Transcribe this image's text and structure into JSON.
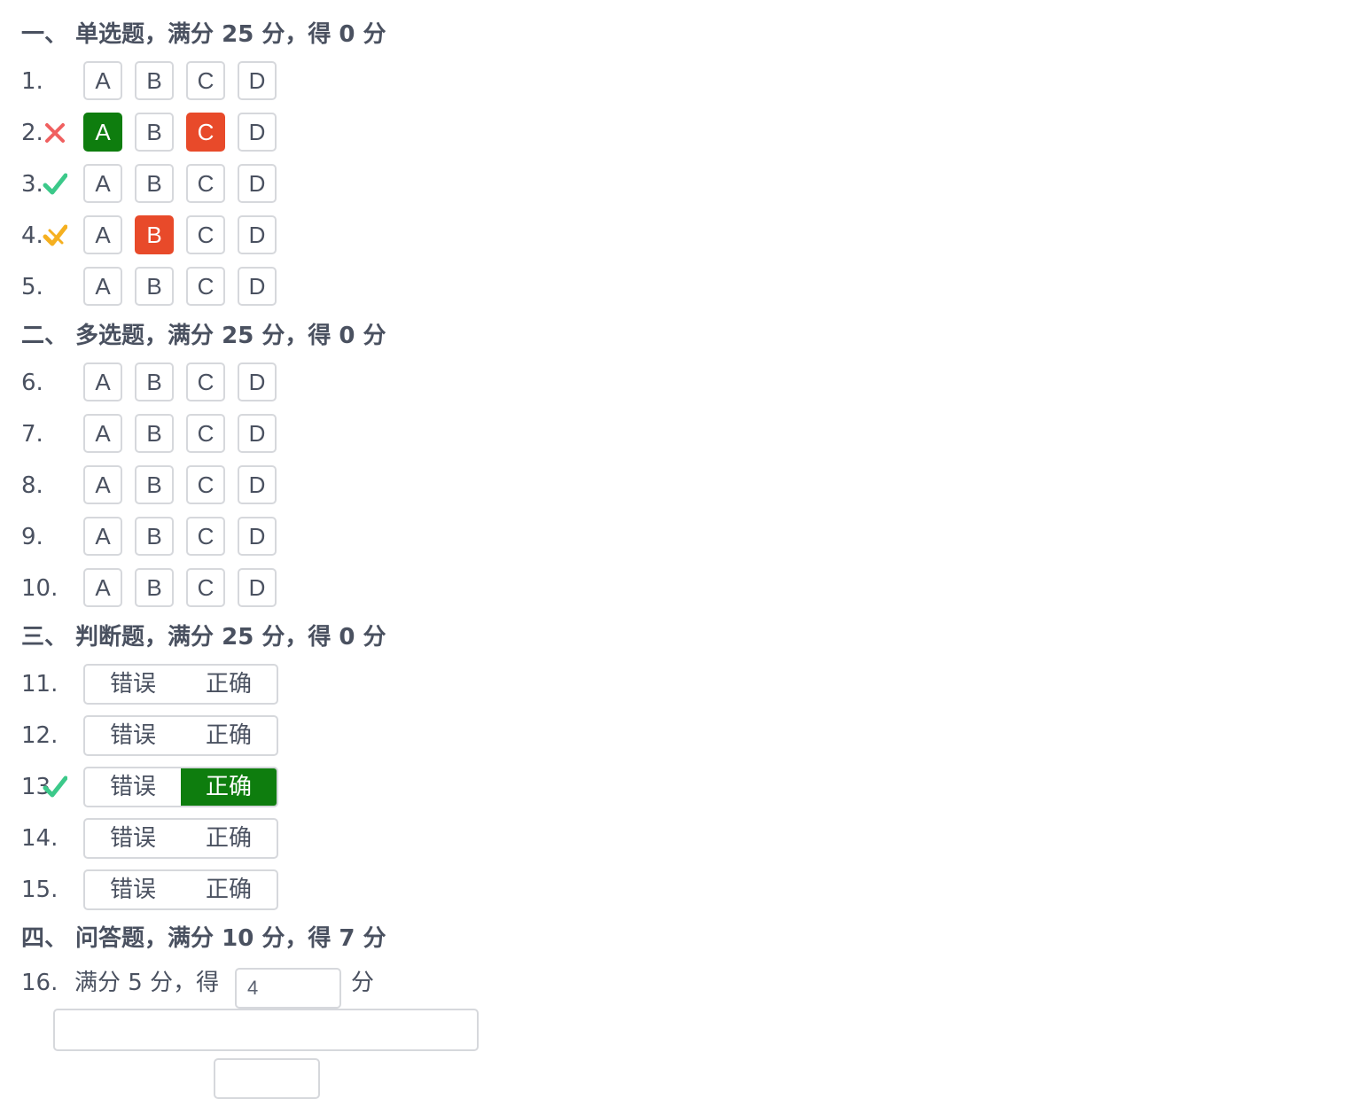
{
  "colors": {
    "correct": "#0e7d0e",
    "wrong": "#e84a2a",
    "check": "#3cc98a",
    "cross": "#f06060",
    "half": "#f5b020",
    "border": "#d6d8dc",
    "text": "#4a5160"
  },
  "sections": [
    {
      "title_prefix": "一、 单选题，满分 ",
      "full": "25",
      "mid": " 分，得 ",
      "got": "0",
      "suffix": " 分"
    },
    {
      "title_prefix": "二、 多选题，满分 ",
      "full": "25",
      "mid": " 分，得 ",
      "got": "0",
      "suffix": " 分"
    },
    {
      "title_prefix": "三、 判断题，满分 ",
      "full": "25",
      "mid": " 分，得 ",
      "got": "0",
      "suffix": " 分"
    },
    {
      "title_prefix": "四、 问答题，满分 ",
      "full": "10",
      "mid": " 分，得 ",
      "got": "7",
      "suffix": " 分"
    }
  ],
  "choice_labels": [
    "A",
    "B",
    "C",
    "D"
  ],
  "tf_labels": [
    "错误",
    "正确"
  ],
  "questions": [
    {
      "num": "1.",
      "mark": ""
    },
    {
      "num": "2.",
      "mark": "cross-icon",
      "correct": "A",
      "wrong": "C"
    },
    {
      "num": "3.",
      "mark": "check-icon"
    },
    {
      "num": "4.",
      "mark": "half-check-icon",
      "wrong": "B"
    },
    {
      "num": "5.",
      "mark": ""
    },
    {
      "num": "6.",
      "mark": ""
    },
    {
      "num": "7.",
      "mark": ""
    },
    {
      "num": "8.",
      "mark": ""
    },
    {
      "num": "9.",
      "mark": ""
    },
    {
      "num": "10.",
      "mark": ""
    },
    {
      "num": "11.",
      "mark": ""
    },
    {
      "num": "12.",
      "mark": ""
    },
    {
      "num": "13.",
      "mark": "check-icon",
      "correct": "正确"
    },
    {
      "num": "14.",
      "mark": ""
    },
    {
      "num": "15.",
      "mark": ""
    }
  ],
  "essay": {
    "num": "16.",
    "text": "满分 5 分，得",
    "score_value": "4",
    "unit": "分",
    "comment_value": ""
  }
}
